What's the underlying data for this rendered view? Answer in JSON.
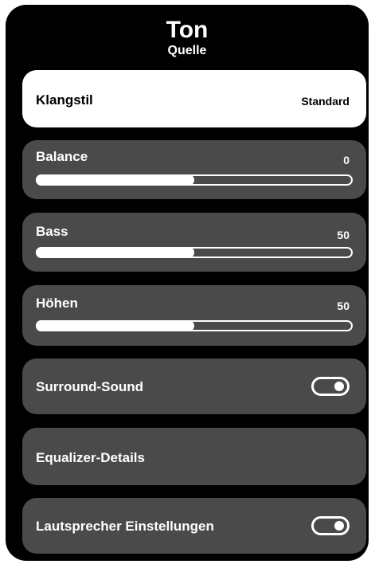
{
  "header": {
    "title": "Ton",
    "subtitle": "Quelle"
  },
  "klangstil": {
    "label": "Klangstil",
    "value": "Standard"
  },
  "balance": {
    "label": "Balance",
    "value": "0",
    "level": 0.5
  },
  "bass": {
    "label": "Bass",
    "value": "50",
    "level": 0.5
  },
  "hoehen": {
    "label": "Höhen",
    "value": "50",
    "level": 0.5
  },
  "surround": {
    "label": "Surround-Sound",
    "enabled": true
  },
  "equalizer": {
    "label": "Equalizer-Details"
  },
  "lautsprecher": {
    "label": "Lautsprecher Einstellungen",
    "enabled": true
  },
  "colors": {
    "panel": "#000000",
    "row": "#4a4a4a",
    "selected": "#ffffff",
    "accent": "#ffffff"
  }
}
